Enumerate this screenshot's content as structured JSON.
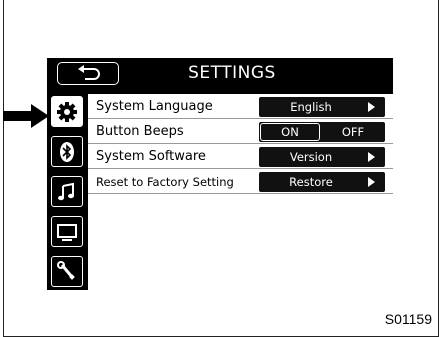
{
  "header": {
    "title": "SETTINGS",
    "back_icon": "back-arrow-icon"
  },
  "sidebar": {
    "items": [
      {
        "name": "settings",
        "icon": "gear-icon",
        "active": true
      },
      {
        "name": "bluetooth",
        "icon": "bluetooth-icon",
        "active": false
      },
      {
        "name": "audio",
        "icon": "music-note-icon",
        "active": false
      },
      {
        "name": "display",
        "icon": "display-icon",
        "active": false
      },
      {
        "name": "tools",
        "icon": "wrench-icon",
        "active": false
      }
    ]
  },
  "settings": [
    {
      "label": "System Language",
      "control": "English"
    },
    {
      "label": "Button Beeps",
      "on_label": "ON",
      "off_label": "OFF",
      "selected": "ON"
    },
    {
      "label": "System Software",
      "control": "Version"
    },
    {
      "label": "Reset to Factory Setting",
      "control": "Restore"
    }
  ],
  "figure_code": "S01159",
  "colors": {
    "screen": "#000000",
    "control": "#111111",
    "text_light": "#ffffff"
  }
}
